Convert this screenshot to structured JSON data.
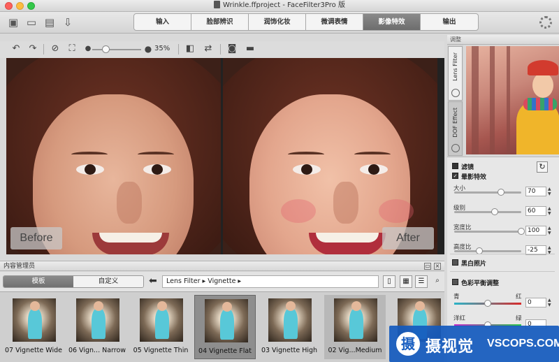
{
  "window": {
    "title": "Wrinkle.ffproject - FaceFilter3Pro 版"
  },
  "toolbar": {
    "tabs": [
      {
        "label": "输入"
      },
      {
        "label": "脸部辨识"
      },
      {
        "label": "润饰化妆"
      },
      {
        "label": "微调表情"
      },
      {
        "label": "影像特效"
      },
      {
        "label": "输出"
      }
    ],
    "active_tab": "影像特效"
  },
  "editor": {
    "zoom": "35%",
    "zoom_fraction": 0.35
  },
  "photos": {
    "before_label": "Before",
    "after_label": "After"
  },
  "content_manager": {
    "title": "内容管理员",
    "tabs": [
      {
        "label": "模板"
      },
      {
        "label": "自定义"
      }
    ],
    "path": "Lens Filter ▸ Vignette ▸",
    "thumbnails": [
      {
        "name": "07 Vignette Wide"
      },
      {
        "name": "06 Vign... Narrow"
      },
      {
        "name": "05 Vignette Thin"
      },
      {
        "name": "04 Vignette Flat",
        "selected": true
      },
      {
        "name": "03 Vignette High"
      },
      {
        "name": "02 Vig...Medium"
      }
    ]
  },
  "right_panel": {
    "title": "调整",
    "side_tabs": [
      {
        "label": "Lens Filter"
      },
      {
        "label": "DOF Effect"
      }
    ],
    "filter_section": "滤镜",
    "vignette_section": "晕影特效",
    "params": [
      {
        "label": "大小",
        "value": "70",
        "fraction": 0.7
      },
      {
        "label": "级别",
        "value": "60",
        "fraction": 0.6
      },
      {
        "label": "宽度比",
        "value": "100",
        "fraction": 1.0
      },
      {
        "label": "高度比",
        "value": "-25",
        "fraction": 0.375
      }
    ],
    "bw_section": "黑白照片",
    "color_balance_section": "色彩平衡调整",
    "color_balance": [
      {
        "left": "青",
        "right": "红",
        "value": "0"
      },
      {
        "left": "洋红",
        "right": "绿",
        "value": "0"
      }
    ]
  },
  "watermark": {
    "cn": "摄视觉",
    "en": "VSCOPS.COM",
    "logo": "摄"
  }
}
